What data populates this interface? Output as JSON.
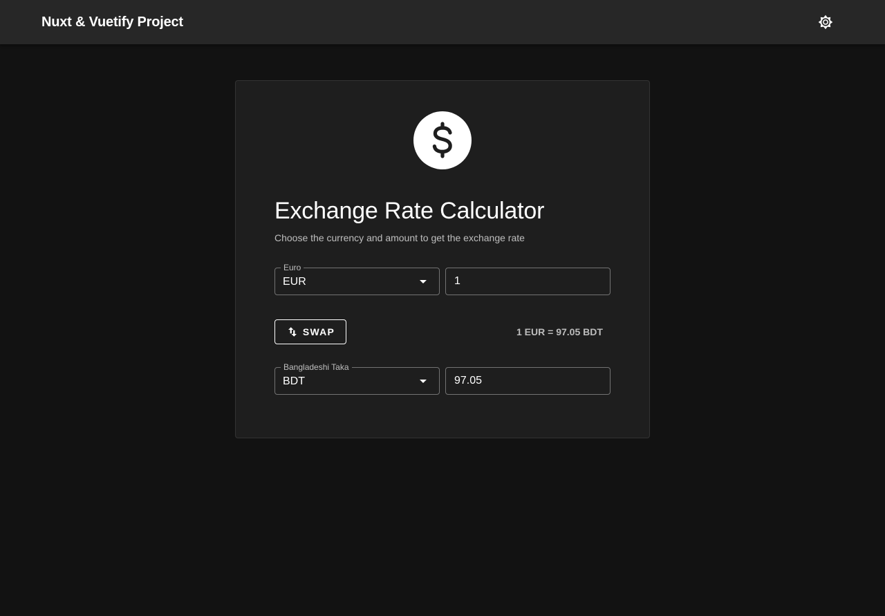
{
  "app_bar": {
    "title": "Nuxt & Vuetify Project",
    "theme_icon": "theme-toggle-icon"
  },
  "card": {
    "logo_icon": "dollar-sign-icon",
    "title": "Exchange Rate Calculator",
    "subtitle": "Choose the currency and amount to get the exchange rate",
    "from": {
      "label": "Euro",
      "currency": "EUR",
      "amount": "1"
    },
    "swap_label": "SWAP",
    "rate_text": "1 EUR = 97.05 BDT",
    "to": {
      "label": "Bangladeshi Taka",
      "currency": "BDT",
      "amount": "97.05"
    }
  },
  "colors": {
    "background": "#121212",
    "app_bar": "#272727",
    "card": "#1e1e1e",
    "text": "#ffffff"
  }
}
